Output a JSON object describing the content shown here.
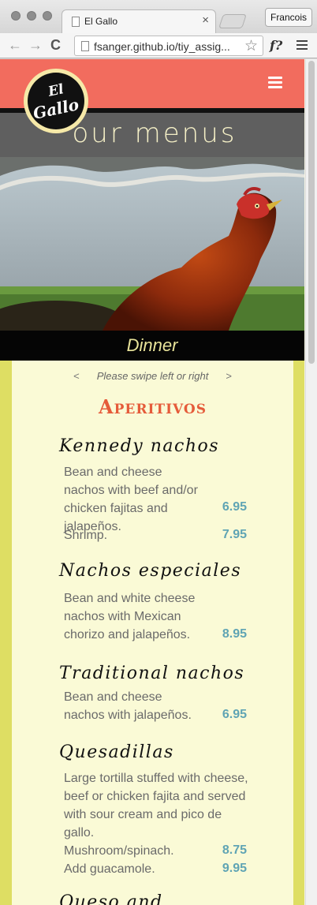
{
  "browser": {
    "tab_title": "El Gallo",
    "tab_close": "×",
    "profile_name": "Francois",
    "url": "fsanger.github.io/tiy_assig...",
    "back_glyph": "←",
    "forward_glyph": "→",
    "reload_glyph": "C",
    "star_glyph": "☆",
    "extension_label": "f?"
  },
  "site": {
    "logo_line1": "El",
    "logo_line2": "Gallo",
    "page_title": "our menus",
    "menu_label": "Dinner",
    "swipe_hint": "Please swipe left or right",
    "swipe_prev": "<",
    "swipe_next": ">",
    "section_heading": "Aperitivos",
    "colors": {
      "header": "#f26c5e",
      "title_bar": "#5f5f5f",
      "title_text": "#f4efc6",
      "panel_border": "#dede63",
      "panel_bg": "#fafad6",
      "heading": "#e55b3a",
      "price": "#5fa4b4"
    }
  },
  "menu_items": [
    {
      "name": "Kennedy nachos",
      "description": "Bean and cheese nachos with beef and/or chicken fajitas and jalapeños.",
      "price": "6.95",
      "extra_label": "Shrimp.",
      "extra_price": "7.95"
    },
    {
      "name": "Nachos especiales",
      "description": "Bean and white cheese nachos with Mexican chorizo and jalapeños.",
      "price": "8.95"
    },
    {
      "name": "Traditional nachos",
      "description": "Bean and cheese nachos with jalapeños.",
      "price": "6.95"
    },
    {
      "name": "Quesadillas",
      "description": "Large tortilla stuffed with cheese, beef or chicken fajita and served with sour cream and pico de gallo.",
      "option1_label": "Mushroom/spinach.",
      "option1_price": "8.75",
      "option2_label": "Add guacamole.",
      "option2_price": "9.95"
    },
    {
      "name": "Queso and chorizo"
    }
  ],
  "icons": {
    "hamburger": "menu-icon",
    "page": "page-icon",
    "star": "bookmark-star-icon"
  }
}
